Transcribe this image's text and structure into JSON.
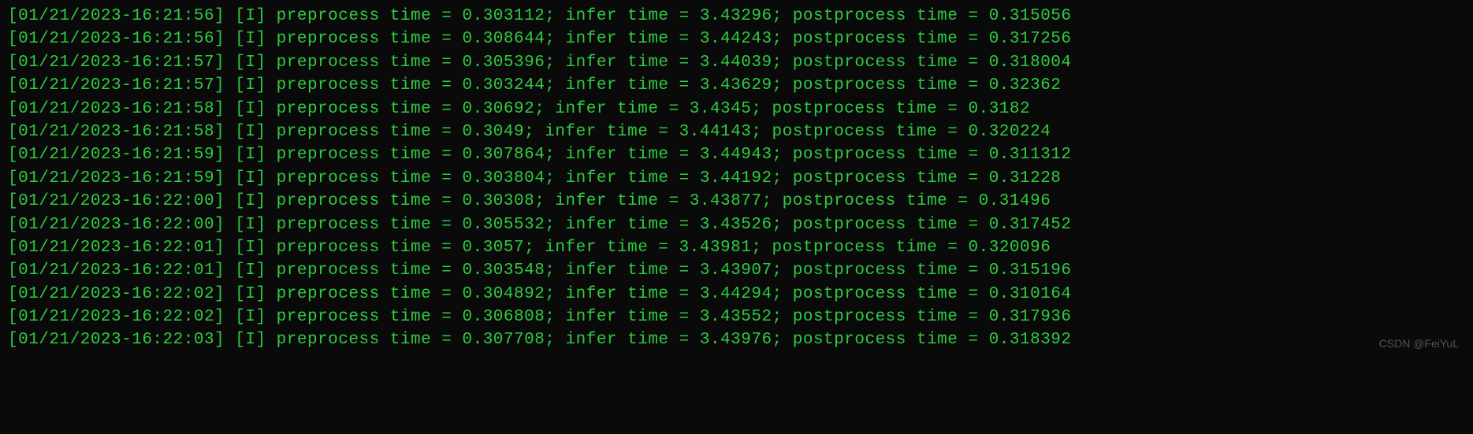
{
  "watermark": "CSDN @FeiYuL",
  "log": {
    "level": "[I]",
    "preprocess_label": "preprocess time",
    "infer_label": "infer time",
    "postprocess_label": "postprocess time",
    "entries": [
      {
        "ts": "[01/21/2023-16:21:56]",
        "pre": "0.303112",
        "inf": "3.43296",
        "post": "0.315056"
      },
      {
        "ts": "[01/21/2023-16:21:56]",
        "pre": "0.308644",
        "inf": "3.44243",
        "post": "0.317256"
      },
      {
        "ts": "[01/21/2023-16:21:57]",
        "pre": "0.305396",
        "inf": "3.44039",
        "post": "0.318004"
      },
      {
        "ts": "[01/21/2023-16:21:57]",
        "pre": "0.303244",
        "inf": "3.43629",
        "post": "0.32362"
      },
      {
        "ts": "[01/21/2023-16:21:58]",
        "pre": "0.30692",
        "inf": "3.4345",
        "post": "0.3182"
      },
      {
        "ts": "[01/21/2023-16:21:58]",
        "pre": "0.3049",
        "inf": "3.44143",
        "post": "0.320224"
      },
      {
        "ts": "[01/21/2023-16:21:59]",
        "pre": "0.307864",
        "inf": "3.44943",
        "post": "0.311312"
      },
      {
        "ts": "[01/21/2023-16:21:59]",
        "pre": "0.303804",
        "inf": "3.44192",
        "post": "0.31228"
      },
      {
        "ts": "[01/21/2023-16:22:00]",
        "pre": "0.30308",
        "inf": "3.43877",
        "post": "0.31496"
      },
      {
        "ts": "[01/21/2023-16:22:00]",
        "pre": "0.305532",
        "inf": "3.43526",
        "post": "0.317452"
      },
      {
        "ts": "[01/21/2023-16:22:01]",
        "pre": "0.3057",
        "inf": "3.43981",
        "post": "0.320096"
      },
      {
        "ts": "[01/21/2023-16:22:01]",
        "pre": "0.303548",
        "inf": "3.43907",
        "post": "0.315196"
      },
      {
        "ts": "[01/21/2023-16:22:02]",
        "pre": "0.304892",
        "inf": "3.44294",
        "post": "0.310164"
      },
      {
        "ts": "[01/21/2023-16:22:02]",
        "pre": "0.306808",
        "inf": "3.43552",
        "post": "0.317936"
      },
      {
        "ts": "[01/21/2023-16:22:03]",
        "pre": "0.307708",
        "inf": "3.43976",
        "post": "0.318392"
      }
    ]
  }
}
